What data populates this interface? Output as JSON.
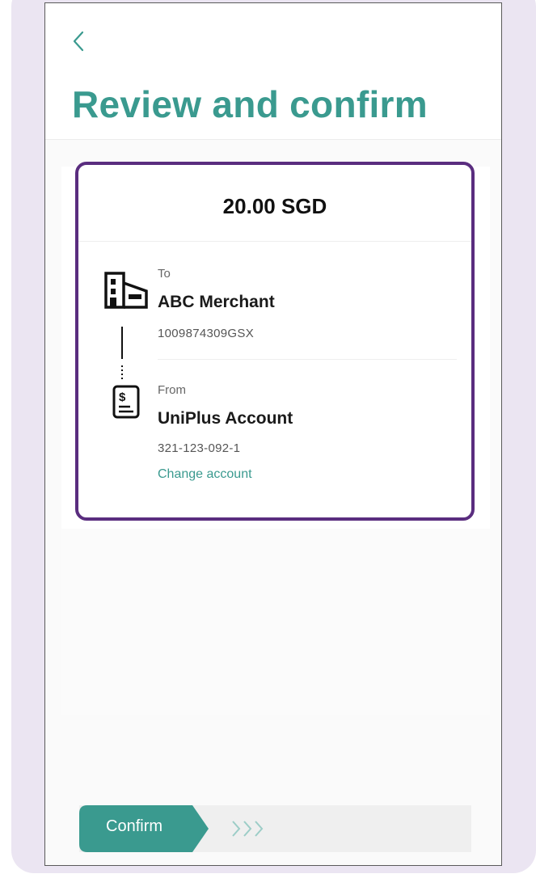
{
  "header": {
    "back_icon": "chevron-left-icon",
    "title": "Review and confirm"
  },
  "payment": {
    "amount": "20.00 SGD",
    "to": {
      "label": "To",
      "name": "ABC Merchant",
      "number": "1009874309GSX",
      "icon": "building-icon"
    },
    "from": {
      "label": "From",
      "name": "UniPlus Account",
      "number": "321-123-092-1",
      "icon": "account-receipt-icon",
      "change_label": "Change account"
    }
  },
  "footer": {
    "confirm_label": "Confirm",
    "arrows": ">>>"
  },
  "colors": {
    "accent": "#3a9a8f",
    "highlight_border": "#5a2d7f",
    "frame_background": "#ebe5f2"
  }
}
